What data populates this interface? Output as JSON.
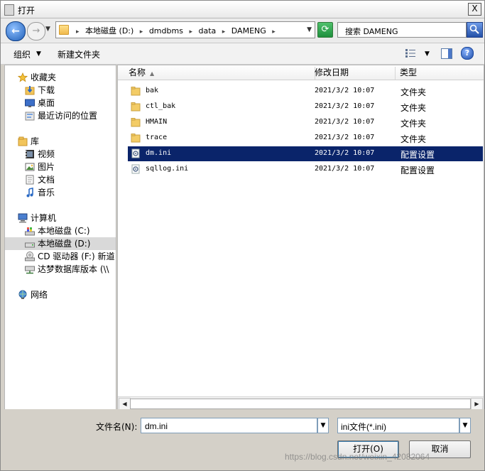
{
  "window": {
    "title": "打开",
    "close": "X"
  },
  "nav": {
    "back_glyph": "←",
    "forward_glyph": "→",
    "breadcrumb": [
      "本地磁盘 (D:)",
      "dmdbms",
      "data",
      "DAMENG"
    ],
    "crumb_sep": "▸",
    "dropdown_glyph": "▼",
    "refresh_glyph": "⟳",
    "search_placeholder": "搜索 DAMENG"
  },
  "toolbar": {
    "organize": "组织",
    "new_folder": "新建文件夹",
    "dropdown_glyph": "▼",
    "help": "?"
  },
  "sidebar": {
    "favorites": {
      "label": "收藏夹",
      "items": [
        "下载",
        "桌面",
        "最近访问的位置"
      ]
    },
    "libraries": {
      "label": "库",
      "items": [
        "视频",
        "图片",
        "文档",
        "音乐"
      ]
    },
    "computer": {
      "label": "计算机",
      "items": [
        "本地磁盘 (C:)",
        "本地磁盘 (D:)",
        "CD 驱动器 (F:) 新道",
        "达梦数据库版本 (\\\\"
      ]
    },
    "network": {
      "label": "网络"
    },
    "selected": "本地磁盘 (D:)"
  },
  "columns": {
    "name": "名称",
    "date": "修改日期",
    "type": "类型",
    "sort_glyph": "▲"
  },
  "files": [
    {
      "name": "bak",
      "date": "2021/3/2 10:07",
      "type": "文件夹",
      "icon": "folder-icon"
    },
    {
      "name": "ctl_bak",
      "date": "2021/3/2 10:07",
      "type": "文件夹",
      "icon": "folder-icon"
    },
    {
      "name": "HMAIN",
      "date": "2021/3/2 10:07",
      "type": "文件夹",
      "icon": "folder-icon"
    },
    {
      "name": "trace",
      "date": "2021/3/2 10:07",
      "type": "文件夹",
      "icon": "folder-icon"
    },
    {
      "name": "dm.ini",
      "date": "2021/3/2 10:07",
      "type": "配置设置",
      "icon": "config-file-icon"
    },
    {
      "name": "sqllog.ini",
      "date": "2021/3/2 10:07",
      "type": "配置设置",
      "icon": "config-file-icon"
    }
  ],
  "selected_file": "dm.ini",
  "scroll": {
    "left_glyph": "◀",
    "right_glyph": "▶"
  },
  "bottom": {
    "filename_label": "文件名(N):",
    "filename_value": "dm.ini",
    "filetype_value": "ini文件(*.ini)",
    "open_button": "打开(O)",
    "cancel_button": "取消",
    "dropdown_glyph": "▼"
  },
  "watermark": "https://blog.csdn.net/weixin_42082064"
}
